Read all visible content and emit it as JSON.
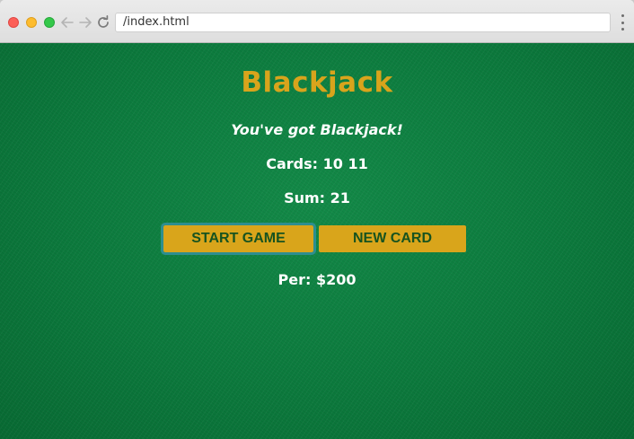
{
  "browser": {
    "url": "/index.html"
  },
  "game": {
    "title": "Blackjack",
    "message": "You've got Blackjack!",
    "cards_text": "Cards: 10 11",
    "sum_text": "Sum: 21",
    "player_text": "Per: $200"
  },
  "buttons": {
    "start_label": "START GAME",
    "new_card_label": "NEW CARD"
  },
  "icons": {
    "back": "arrow-left-icon",
    "forward": "arrow-right-icon",
    "reload": "reload-icon",
    "menu": "vertical-dots-icon"
  },
  "colors": {
    "felt": "#0d7a3e",
    "title": "#d8a41c",
    "button_bg": "#d9a51b",
    "button_text": "#17531f",
    "focus_ring": "#2d8e8f"
  }
}
